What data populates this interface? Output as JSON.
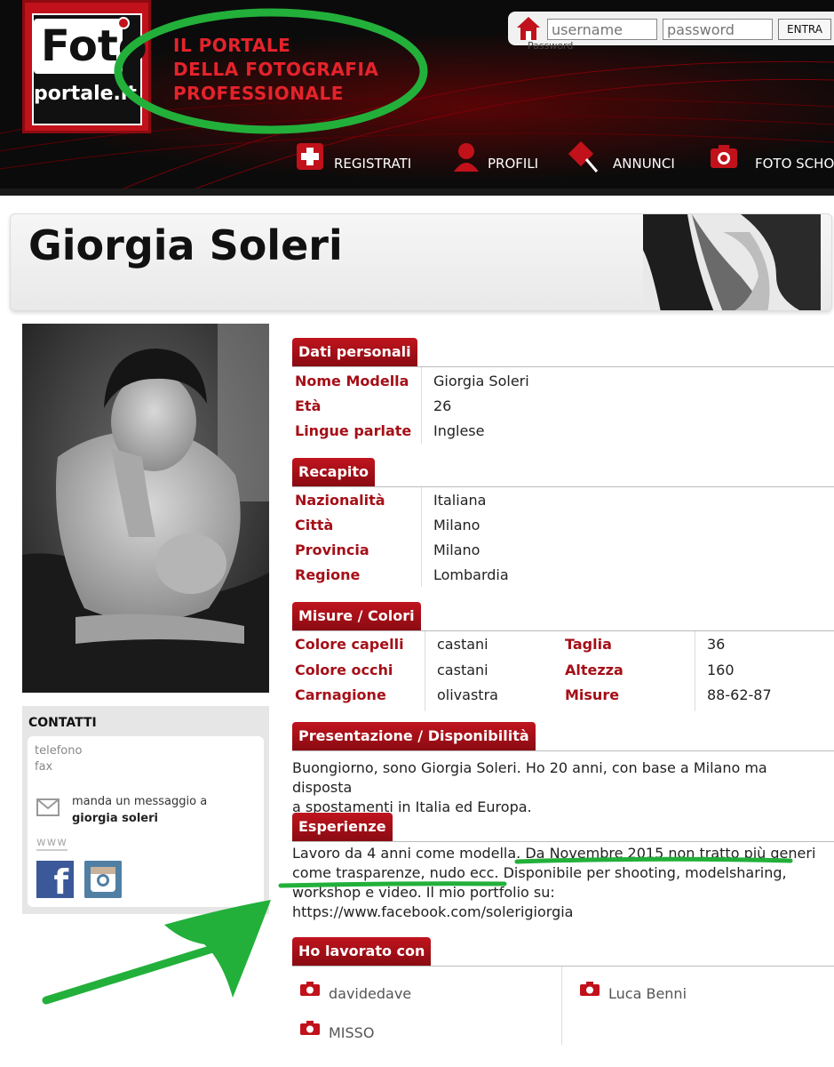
{
  "header": {
    "logo_text": "Foto",
    "logo_sub": "portale.it",
    "tagline": [
      "IL PORTALE",
      "DELLA FOTOGRAFIA",
      "PROFESSIONALE"
    ],
    "login": {
      "username_placeholder": "username",
      "password_placeholder": "password",
      "submit_label": "ENTRA",
      "password_label": "Password"
    },
    "nav": [
      "REGISTRATI",
      "PROFILI",
      "ANNUNCI",
      "FOTO SCHOO"
    ]
  },
  "profile": {
    "name": "Giorgia Soleri"
  },
  "contacts": {
    "title": "CONTATTI",
    "phone_label": "telefono",
    "fax_label": "fax",
    "message_line1": "manda un messaggio a",
    "message_line2": "giorgia soleri",
    "www_label": "www",
    "facebook_glyph": "f"
  },
  "sections": {
    "personal": {
      "title": "Dati personali",
      "rows": [
        {
          "label": "Nome Modella",
          "value": "Giorgia Soleri"
        },
        {
          "label": "Età",
          "value": "26"
        },
        {
          "label": "Lingue parlate",
          "value": "Inglese"
        }
      ]
    },
    "contact": {
      "title": "Recapito",
      "rows": [
        {
          "label": "Nazionalità",
          "value": "Italiana"
        },
        {
          "label": "Città",
          "value": "Milano"
        },
        {
          "label": "Provincia",
          "value": "Milano"
        },
        {
          "label": "Regione",
          "value": "Lombardia"
        }
      ]
    },
    "measures": {
      "title": "Misure / Colori",
      "left": [
        {
          "label": "Colore capelli",
          "value": "castani"
        },
        {
          "label": "Colore occhi",
          "value": "castani"
        },
        {
          "label": "Carnagione",
          "value": "olivastra"
        }
      ],
      "right": [
        {
          "label": "Taglia",
          "value": "36"
        },
        {
          "label": "Altezza",
          "value": "160"
        },
        {
          "label": "Misure",
          "value": "88-62-87"
        }
      ]
    },
    "presentation": {
      "title": "Presentazione / Disponibilità",
      "lines": [
        "Buongiorno, sono Giorgia Soleri. Ho 20 anni, con base a Milano ma disposta",
        "a spostamenti in Italia ed Europa."
      ]
    },
    "experience": {
      "title": "Esperienze",
      "lines": [
        "Lavoro da 4 anni come modella. Da Novembre 2015 non tratto più generi",
        "come trasparenze, nudo ecc. Disponibile per shooting, modelsharing,",
        "workshop e video. Il mio portfolio su:",
        "https://www.facebook.com/solerigiorgia"
      ]
    },
    "worked_with": {
      "title": "Ho lavorato con",
      "people": [
        "davidedave",
        "Luca Benni",
        "MISSO"
      ]
    }
  },
  "colors": {
    "accent_red": "#c0141e",
    "annotation_green": "#22b03a"
  }
}
